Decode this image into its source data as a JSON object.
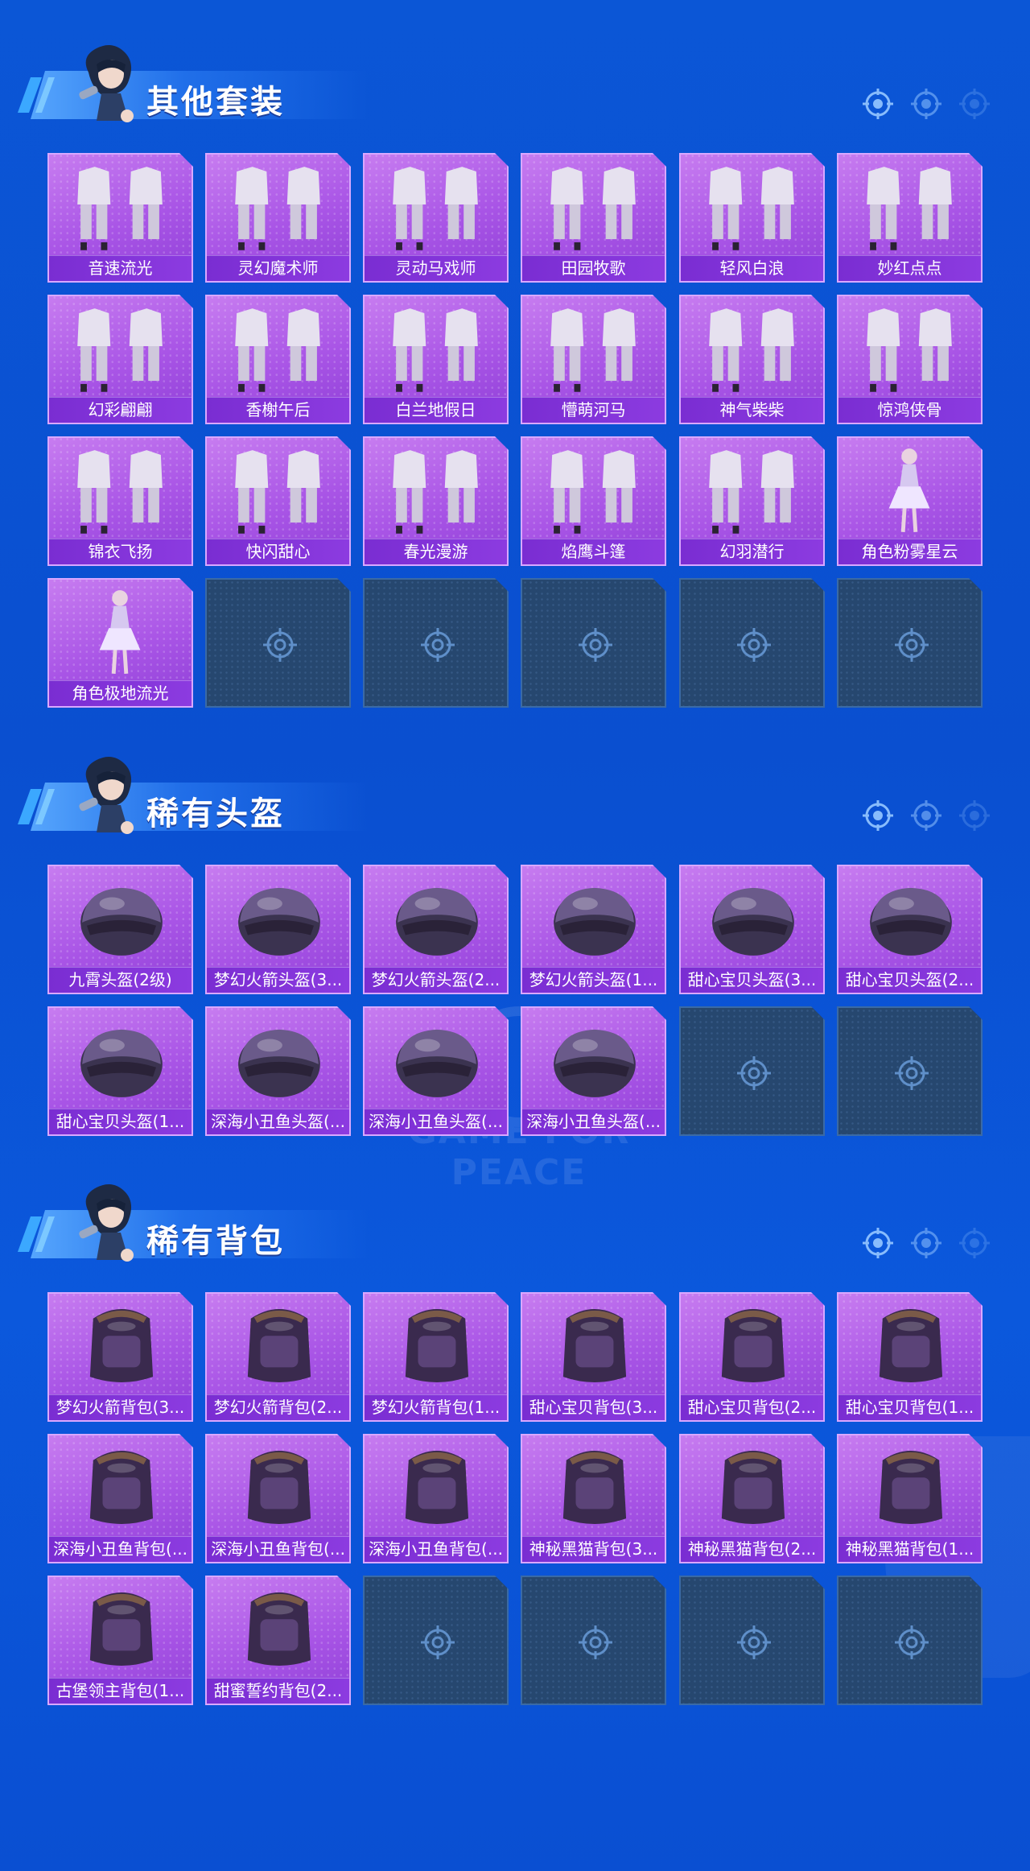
{
  "colors": {
    "background": "#0b56d6",
    "card": "#a955e6",
    "label_bar": "#7a2dd2",
    "empty_slot": "#26476f"
  },
  "sections": [
    {
      "title": "其他套装",
      "items": [
        "音速流光",
        "灵幻魔术师",
        "灵动马戏师",
        "田园牧歌",
        "轻风白浪",
        "妙红点点",
        "幻彩翩翩",
        "香榭午后",
        "白兰地假日",
        "懵萌河马",
        "神气柴柴",
        "惊鸿侠骨",
        "锦衣飞扬",
        "快闪甜心",
        "春光漫游",
        "焰鹰斗篷",
        "幻羽潜行",
        "角色粉雾星云",
        "角色极地流光"
      ],
      "icons": [
        "outfit",
        "outfit",
        "outfit",
        "outfit",
        "outfit",
        "outfit",
        "outfit",
        "outfit",
        "outfit",
        "outfit",
        "outfit",
        "outfit",
        "outfit",
        "outfit",
        "outfit",
        "outfit",
        "outfit",
        "figure",
        "figure"
      ],
      "empty_slots": 5
    },
    {
      "title": "稀有头盔",
      "items": [
        "九霄头盔(2级)",
        "梦幻火箭头盔(3...",
        "梦幻火箭头盔(2...",
        "梦幻火箭头盔(1...",
        "甜心宝贝头盔(3...",
        "甜心宝贝头盔(2...",
        "甜心宝贝头盔(1...",
        "深海小丑鱼头盔(...",
        "深海小丑鱼头盔(...",
        "深海小丑鱼头盔(..."
      ],
      "icons": [
        "helmet",
        "helmet",
        "helmet",
        "helmet",
        "helmet",
        "helmet",
        "helmet",
        "helmet",
        "helmet",
        "helmet"
      ],
      "empty_slots": 2
    },
    {
      "title": "稀有背包",
      "items": [
        "梦幻火箭背包(3...",
        "梦幻火箭背包(2...",
        "梦幻火箭背包(1...",
        "甜心宝贝背包(3...",
        "甜心宝贝背包(2...",
        "甜心宝贝背包(1...",
        "深海小丑鱼背包(...",
        "深海小丑鱼背包(...",
        "深海小丑鱼背包(...",
        "神秘黑猫背包(3...",
        "神秘黑猫背包(2...",
        "神秘黑猫背包(1...",
        "古堡领主背包(1...",
        "甜蜜誓约背包(2..."
      ],
      "icons": [
        "backpack",
        "backpack",
        "backpack",
        "backpack",
        "backpack",
        "backpack",
        "backpack",
        "backpack",
        "backpack",
        "backpack",
        "backpack",
        "backpack",
        "backpack",
        "backpack"
      ],
      "empty_slots": 4
    }
  ]
}
